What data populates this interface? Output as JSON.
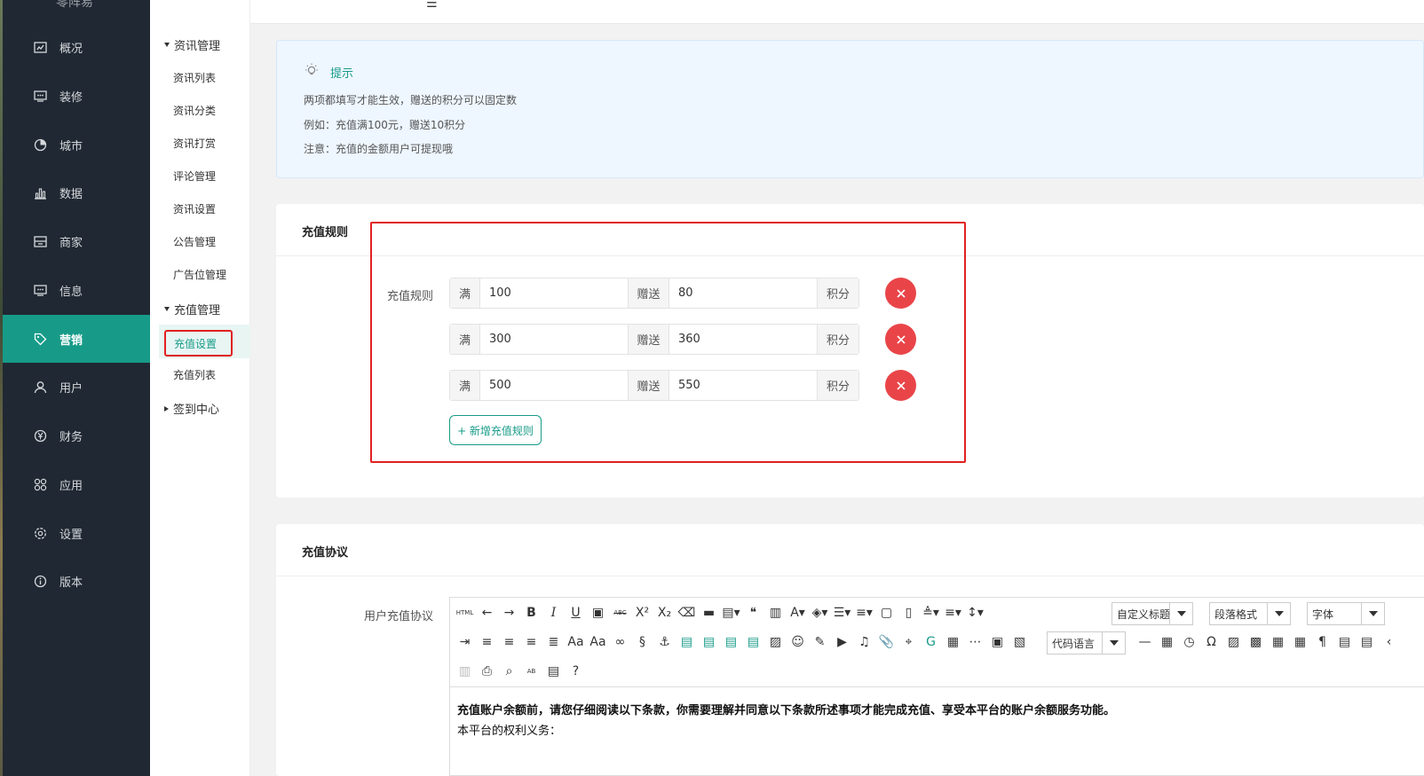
{
  "app": {
    "logo_text": "零阵易"
  },
  "nav": {
    "items": [
      {
        "label": "概况",
        "icon": "dashboard-icon"
      },
      {
        "label": "装修",
        "icon": "decorate-icon"
      },
      {
        "label": "城市",
        "icon": "city-icon"
      },
      {
        "label": "数据",
        "icon": "chart-icon"
      },
      {
        "label": "商家",
        "icon": "shop-icon"
      },
      {
        "label": "信息",
        "icon": "message-icon"
      },
      {
        "label": "营销",
        "icon": "tag-icon",
        "active": true
      },
      {
        "label": "用户",
        "icon": "user-icon"
      },
      {
        "label": "财务",
        "icon": "yen-icon"
      },
      {
        "label": "应用",
        "icon": "apps-icon"
      },
      {
        "label": "设置",
        "icon": "gear-icon"
      },
      {
        "label": "版本",
        "icon": "info-icon"
      }
    ]
  },
  "submenu": {
    "group1": "资讯管理",
    "group1_items": [
      "资讯列表",
      "资讯分类",
      "资讯打赏",
      "评论管理",
      "资讯设置",
      "公告管理",
      "广告位管理"
    ],
    "group2": "充值管理",
    "group2_items": [
      "充值设置",
      "充值列表"
    ],
    "group3": "签到中心"
  },
  "tip": {
    "title": "提示",
    "lines": [
      "两项都填写才能生效，赠送的积分可以固定数",
      "例如：充值满100元，赠送10积分",
      "注意：充值的金额用户可提现哦"
    ]
  },
  "rules_card": {
    "title": "充值规则",
    "field_label": "充值规则",
    "prefix": "满",
    "middle": "赠送",
    "suffix": "积分",
    "rows": [
      {
        "amount": "100",
        "bonus": "80"
      },
      {
        "amount": "300",
        "bonus": "360"
      },
      {
        "amount": "500",
        "bonus": "550"
      }
    ],
    "add_button": "+ 新增充值规则"
  },
  "agreement_card": {
    "title": "充值协议",
    "field_label": "用户充值协议",
    "selects": {
      "custom_title": "自定义标题",
      "paragraph": "段落格式",
      "font": "字体",
      "code_lang": "代码语言"
    },
    "content_line1": "充值账户余额前，请您仔细阅读以下条款，你需要理解并同意以下条款所述事项才能完成充值、享受本平台的账户余额服务功能。",
    "content_line2": "本平台的权利义务："
  },
  "colors": {
    "sidebar": "#202833",
    "accent": "#179b88",
    "danger": "#e94549",
    "highlight": "#e02020"
  }
}
